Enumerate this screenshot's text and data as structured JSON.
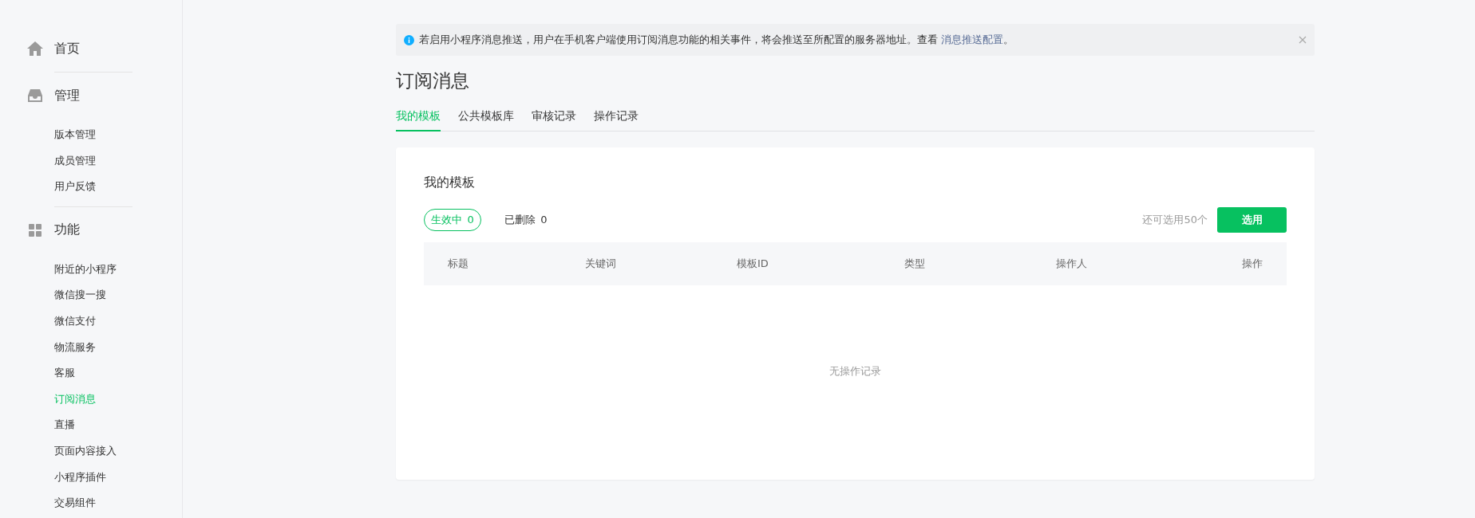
{
  "sidebar": {
    "sections": [
      {
        "title": "首页",
        "kind": "home"
      },
      {
        "title": "管理",
        "kind": "inbox",
        "items": [
          {
            "label": "版本管理",
            "selected": false
          },
          {
            "label": "成员管理",
            "selected": false
          },
          {
            "label": "用户反馈",
            "selected": false
          }
        ]
      },
      {
        "title": "功能",
        "kind": "grid",
        "items": [
          {
            "label": "附近的小程序",
            "selected": false
          },
          {
            "label": "微信搜一搜",
            "selected": false
          },
          {
            "label": "微信支付",
            "selected": false
          },
          {
            "label": "物流服务",
            "selected": false
          },
          {
            "label": "客服",
            "selected": false
          },
          {
            "label": "订阅消息",
            "selected": true
          },
          {
            "label": "直播",
            "selected": false
          },
          {
            "label": "页面内容接入",
            "selected": false
          },
          {
            "label": "小程序插件",
            "selected": false
          },
          {
            "label": "交易组件",
            "selected": false
          }
        ]
      }
    ]
  },
  "notice": {
    "text": "若启用小程序消息推送，用户在手机客户端使用订阅消息功能的相关事件，将会推送至所配置的服务器地址。查看",
    "link": "消息推送配置",
    "end": "。"
  },
  "page_title": "订阅消息",
  "tabs": [
    {
      "label": "我的模板",
      "selected": true
    },
    {
      "label": "公共模板库",
      "selected": false
    },
    {
      "label": "审核记录",
      "selected": false
    },
    {
      "label": "操作记录",
      "selected": false
    }
  ],
  "card": {
    "title": "我的模板",
    "filters": [
      {
        "label": "生效中",
        "count": "0",
        "selected": true
      },
      {
        "label": "已删除",
        "count": "0",
        "selected": false
      }
    ],
    "quota": "还可选用50个",
    "button": "选用",
    "table": {
      "columns": [
        "标题",
        "关键词",
        "模板ID",
        "类型",
        "操作人",
        "操作"
      ],
      "empty": "无操作记录"
    }
  }
}
